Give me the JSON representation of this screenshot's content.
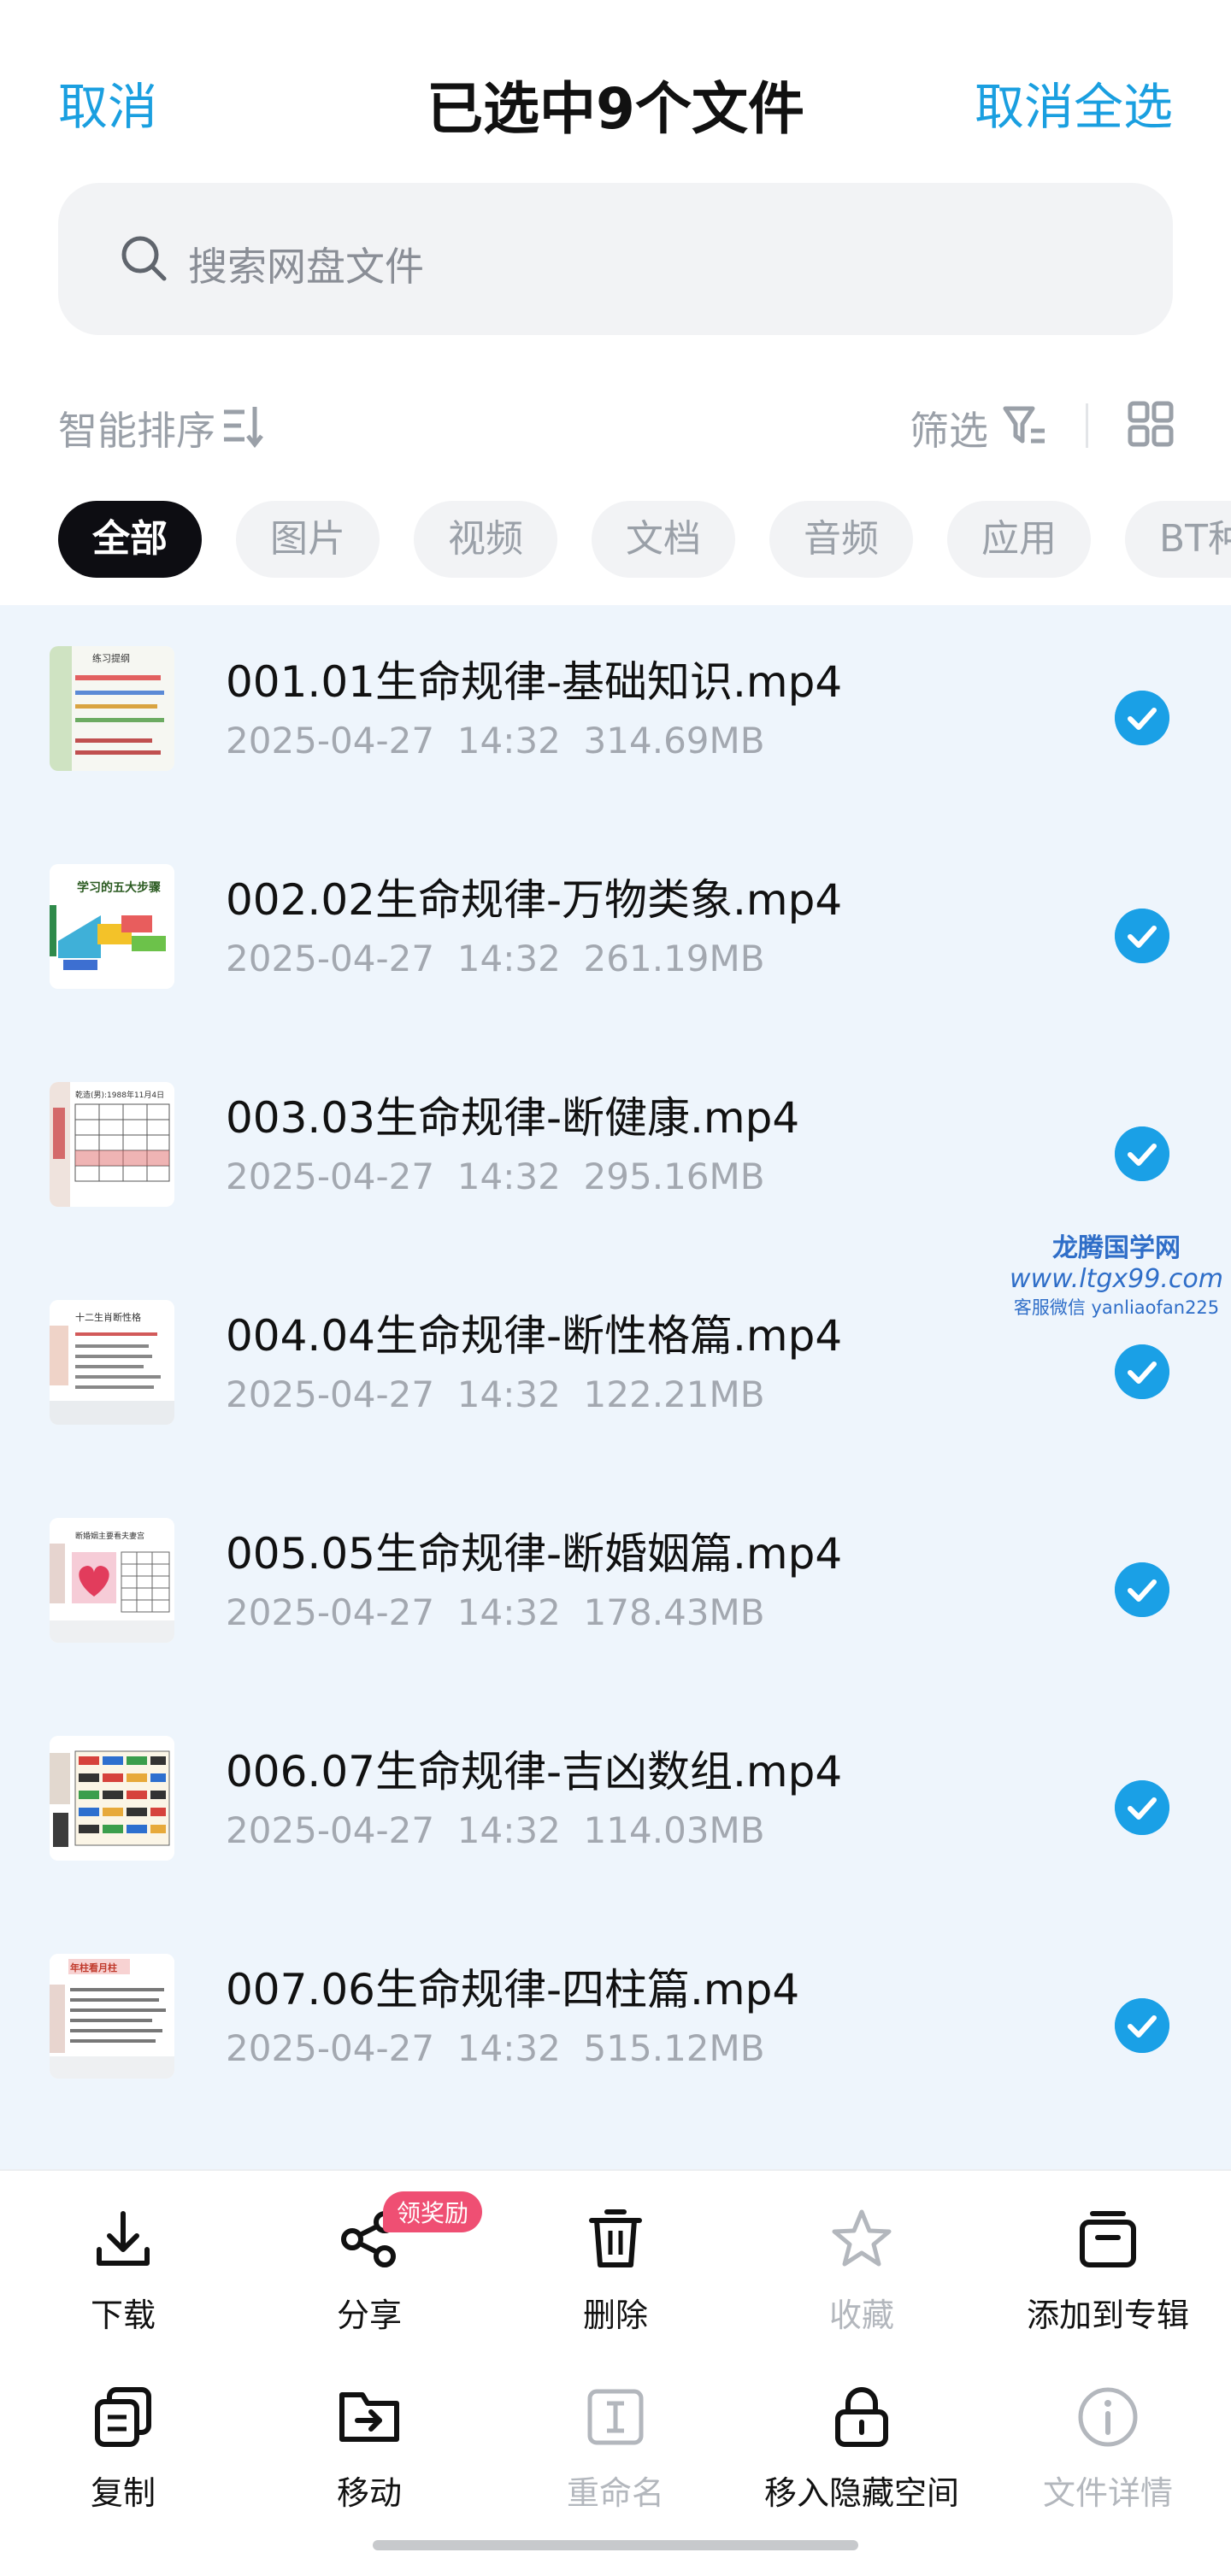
{
  "header": {
    "cancel": "取消",
    "title": "已选中9个文件",
    "cancel_all": "取消全选"
  },
  "search": {
    "placeholder": "搜索网盘文件"
  },
  "toolbar": {
    "sort": "智能排序",
    "filter": "筛选"
  },
  "tabs": [
    {
      "label": "全部",
      "active": true
    },
    {
      "label": "图片"
    },
    {
      "label": "视频"
    },
    {
      "label": "文档"
    },
    {
      "label": "音频"
    },
    {
      "label": "应用"
    },
    {
      "label": "BT种"
    }
  ],
  "files": [
    {
      "name": "001.01生命规律-基础知识.mp4",
      "date": "2025-04-27",
      "time": "14:32",
      "size": "314.69MB"
    },
    {
      "name": "002.02生命规律-万物类象.mp4",
      "date": "2025-04-27",
      "time": "14:32",
      "size": "261.19MB"
    },
    {
      "name": "003.03生命规律-断健康.mp4",
      "date": "2025-04-27",
      "time": "14:32",
      "size": "295.16MB"
    },
    {
      "name": "004.04生命规律-断性格篇.mp4",
      "date": "2025-04-27",
      "time": "14:32",
      "size": "122.21MB"
    },
    {
      "name": "005.05生命规律-断婚姻篇.mp4",
      "date": "2025-04-27",
      "time": "14:32",
      "size": "178.43MB"
    },
    {
      "name": "006.07生命规律-吉凶数组.mp4",
      "date": "2025-04-27",
      "time": "14:32",
      "size": "114.03MB"
    },
    {
      "name": "007.06生命规律-四柱篇.mp4",
      "date": "2025-04-27",
      "time": "14:32",
      "size": "515.12MB"
    }
  ],
  "thumb_texts": {
    "t1": "练习提纲",
    "t2": "学习的五大步骤",
    "t3": "乾造(男):1988年11月4日",
    "t4": "十二生肖断性格",
    "t5": "断婚姻主要看夫妻宫",
    "t7": "年柱看月柱"
  },
  "watermark": {
    "line1": "龙腾国学网",
    "line2": "www.ltgx99.com",
    "line3": "客服微信 yanliaofan225"
  },
  "actions": {
    "download": "下载",
    "share": "分享",
    "share_badge": "领奖励",
    "delete": "删除",
    "favorite": "收藏",
    "add_album": "添加到专辑",
    "copy": "复制",
    "move": "移动",
    "rename": "重命名",
    "hide": "移入隐藏空间",
    "details": "文件详情"
  },
  "colors": {
    "accent": "#1a9fe0",
    "check": "#1aa0e6",
    "badge": "#ef4f73",
    "list_bg": "#eef5fc",
    "active_tab": "#0d0d12"
  },
  "icons": [
    "search-icon",
    "sort-icon",
    "filter-icon",
    "grid-view-icon",
    "check-icon",
    "download-icon",
    "share-icon",
    "trash-icon",
    "star-icon",
    "album-icon",
    "copy-icon",
    "move-icon",
    "rename-icon",
    "lock-icon",
    "info-icon"
  ]
}
